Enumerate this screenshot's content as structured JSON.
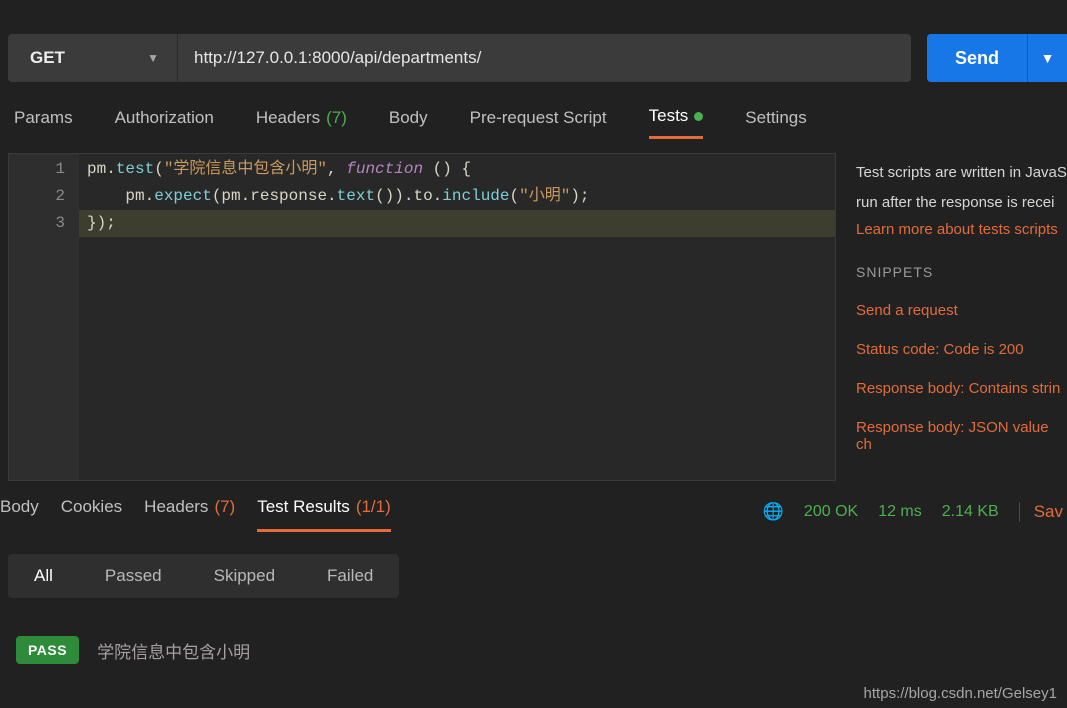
{
  "request": {
    "method": "GET",
    "url": "http://127.0.0.1:8000/api/departments/",
    "send_label": "Send"
  },
  "req_tabs": {
    "params": "Params",
    "auth": "Authorization",
    "headers": "Headers",
    "headers_count": "(7)",
    "body": "Body",
    "prereq": "Pre-request Script",
    "tests": "Tests",
    "settings": "Settings"
  },
  "editor": {
    "lines": [
      "1",
      "2",
      "3"
    ],
    "line1_a": "pm.",
    "line1_b": "test",
    "line1_c": "(",
    "line1_d": "\"学院信息中包含小明\"",
    "line1_e": ", ",
    "line1_f": "function",
    "line1_g": " () {",
    "line2_a": "    pm.",
    "line2_b": "expect",
    "line2_c": "(pm.response.",
    "line2_d": "text",
    "line2_e": "()).to.",
    "line2_f": "include",
    "line2_g": "(",
    "line2_h": "\"小明\"",
    "line2_i": ");",
    "line3": "});"
  },
  "side": {
    "desc1": "Test scripts are written in JavaS",
    "desc2": "run after the response is recei",
    "learn": "Learn more about tests scripts",
    "snip_title": "SNIPPETS",
    "snippets": [
      "Send a request",
      "Status code: Code is 200",
      "Response body: Contains strin",
      "Response body: JSON value ch"
    ]
  },
  "resp_tabs": {
    "body": "Body",
    "cookies": "Cookies",
    "headers": "Headers",
    "headers_count": "(7)",
    "test_results": "Test Results",
    "test_count": "(1/1)"
  },
  "resp_meta": {
    "status": "200 OK",
    "time": "12 ms",
    "size": "2.14 KB",
    "save": "Sav"
  },
  "filters": {
    "all": "All",
    "passed": "Passed",
    "skipped": "Skipped",
    "failed": "Failed"
  },
  "result": {
    "badge": "PASS",
    "name": "学院信息中包含小明"
  },
  "watermark": "https://blog.csdn.net/Gelsey1"
}
